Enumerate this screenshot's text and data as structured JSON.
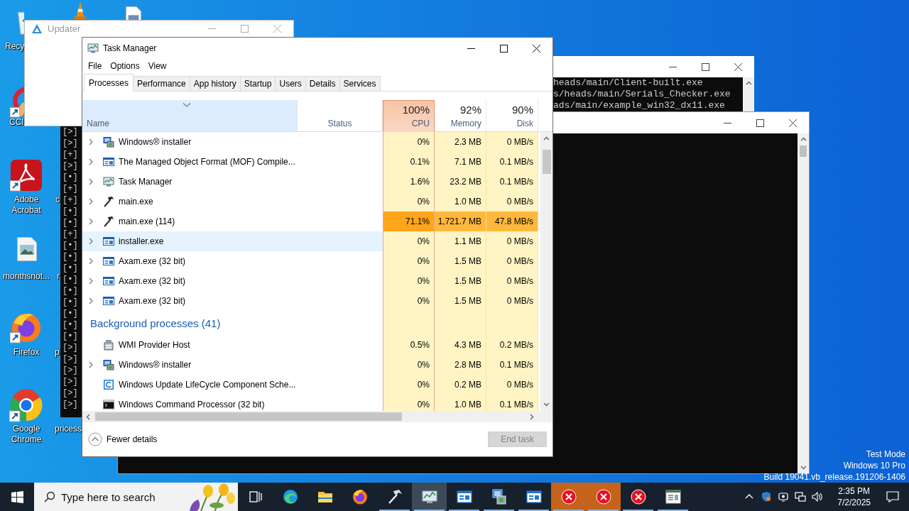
{
  "desktop": {
    "icons": [
      {
        "kind": "recycle-bin",
        "label": "Recy",
        "shortcut": false
      },
      {
        "kind": "cone"
      },
      {
        "kind": "document"
      },
      {
        "kind": "cleaner",
        "label": "CCl",
        "shortcut": true
      },
      {
        "kind": "pdf",
        "label": "Adobe Acrobat",
        "shortcut": true
      },
      {
        "kind": "covered",
        "label": "c"
      },
      {
        "kind": "image-file",
        "label": "monthsnot...",
        "shortcut": false
      },
      {
        "kind": "covered",
        "label": "r"
      },
      {
        "kind": "fox-browser",
        "label": "Firefox",
        "shortcut": true
      },
      {
        "kind": "covered",
        "label": "p"
      },
      {
        "kind": "round-browser",
        "label": "Google Chrome",
        "shortcut": true
      },
      {
        "kind": "covered",
        "label": "pricess"
      }
    ],
    "system_notice": [
      "Test Mode",
      "Windows 10 Pro",
      "Build 19041.vb_release.191206-1406"
    ]
  },
  "updater": {
    "title": "Updater"
  },
  "console_left": {
    "lines": [
      "[>]",
      "[>]",
      "[+]",
      "[>]",
      "[•]",
      "[+]",
      "[+]",
      "[•]",
      "[•]",
      "[+]",
      "[•]",
      "[•]",
      "[•]",
      "[•]",
      "[•]",
      "[•]",
      "[•]",
      "[•]",
      "[•]",
      "[>]",
      "[>]",
      "[>]",
      "[>]",
      "[>]",
      "[>]"
    ]
  },
  "console_top": {
    "lines": [
      "heads/main/Client-built.exe",
      "s/heads/main/Serials_Checker.exe",
      "ads/main/example_win32_dx11.exe"
    ]
  },
  "task_manager": {
    "title": "Task Manager",
    "menu": [
      "File",
      "Options",
      "View"
    ],
    "tabs": [
      {
        "label": "Processes",
        "selected": true
      },
      {
        "label": "Performance",
        "selected": false
      },
      {
        "label": "App history",
        "selected": false
      },
      {
        "label": "Startup",
        "selected": false
      },
      {
        "label": "Users",
        "selected": false
      },
      {
        "label": "Details",
        "selected": false
      },
      {
        "label": "Services",
        "selected": false
      }
    ],
    "columns": [
      {
        "label": "Name"
      },
      {
        "label": "Status"
      },
      {
        "label": "CPU",
        "usage": "100%",
        "hot": true
      },
      {
        "label": "Memory",
        "usage": "92%",
        "hot": false
      },
      {
        "label": "Disk",
        "usage": "90%",
        "hot": false
      }
    ],
    "rows": [
      {
        "kind": "installer",
        "name": "Windows® installer",
        "expandable": true,
        "selected": false,
        "hot": false,
        "cpu": "0%",
        "memory": "2.3 MB",
        "disk": "0 MB/s"
      },
      {
        "kind": "window",
        "name": "The Managed Object Format (MOF) Compile...",
        "expandable": true,
        "selected": false,
        "hot": false,
        "cpu": "0.1%",
        "memory": "7.1 MB",
        "disk": "0.1 MB/s"
      },
      {
        "kind": "monitor",
        "name": "Task Manager",
        "expandable": true,
        "selected": false,
        "hot": false,
        "cpu": "1.6%",
        "memory": "23.2 MB",
        "disk": "0.1 MB/s"
      },
      {
        "kind": "hammer",
        "name": "main.exe",
        "expandable": true,
        "selected": false,
        "hot": false,
        "cpu": "0%",
        "memory": "1.0 MB",
        "disk": "0 MB/s"
      },
      {
        "kind": "hammer",
        "name": "main.exe (114)",
        "expandable": true,
        "selected": false,
        "hot": true,
        "cpu": "71.1%",
        "memory": "1,721.7 MB",
        "disk": "47.8 MB/s"
      },
      {
        "kind": "window",
        "name": "installer.exe",
        "expandable": true,
        "selected": true,
        "hot": false,
        "cpu": "0%",
        "memory": "1.1 MB",
        "disk": "0 MB/s"
      },
      {
        "kind": "window",
        "name": "Axam.exe (32 bit)",
        "expandable": true,
        "selected": false,
        "hot": false,
        "cpu": "0%",
        "memory": "1.5 MB",
        "disk": "0 MB/s"
      },
      {
        "kind": "window",
        "name": "Axam.exe (32 bit)",
        "expandable": true,
        "selected": false,
        "hot": false,
        "cpu": "0%",
        "memory": "1.5 MB",
        "disk": "0 MB/s"
      },
      {
        "kind": "window",
        "name": "Axam.exe (32 bit)",
        "expandable": true,
        "selected": false,
        "hot": false,
        "cpu": "0%",
        "memory": "1.5 MB",
        "disk": "0 MB/s"
      },
      {
        "kind": "group",
        "name": "Background processes (41)"
      },
      {
        "kind": "server",
        "name": "WMI Provider Host",
        "expandable": false,
        "selected": false,
        "hot": false,
        "cpu": "0.5%",
        "memory": "4.3 MB",
        "disk": "0.2 MB/s"
      },
      {
        "kind": "installer",
        "name": "Windows® installer",
        "expandable": true,
        "selected": false,
        "hot": false,
        "cpu": "0%",
        "memory": "2.8 MB",
        "disk": "0.1 MB/s"
      },
      {
        "kind": "update",
        "name": "Windows Update LifeCycle Component Sche...",
        "expandable": false,
        "selected": false,
        "hot": false,
        "cpu": "0%",
        "memory": "0.2 MB",
        "disk": "0 MB/s"
      },
      {
        "kind": "console",
        "name": "Windows Command Processor (32 bit)",
        "expandable": false,
        "selected": false,
        "hot": false,
        "cpu": "0%",
        "memory": "1.0 MB",
        "disk": "0.1 MB/s"
      }
    ],
    "footer": {
      "toggle": "Fewer details",
      "end_task": {
        "label": "End task",
        "disabled": true
      }
    }
  },
  "taskbar": {
    "search": {
      "placeholder": "Type here to search"
    },
    "items": [
      {
        "kind": "task-view",
        "selected": false,
        "flashing": false,
        "running": false
      },
      {
        "kind": "wave-browser",
        "selected": false,
        "flashing": false,
        "running": false
      },
      {
        "kind": "folder",
        "selected": false,
        "flashing": false,
        "running": false
      },
      {
        "kind": "fox-browser",
        "selected": false,
        "flashing": false,
        "running": false
      },
      {
        "kind": "hammer",
        "selected": false,
        "flashing": false,
        "running": true
      },
      {
        "kind": "monitor",
        "selected": true,
        "flashing": false,
        "running": true
      },
      {
        "kind": "window",
        "selected": false,
        "flashing": false,
        "running": true
      },
      {
        "kind": "installer",
        "selected": false,
        "flashing": false,
        "running": true
      },
      {
        "kind": "window",
        "selected": false,
        "flashing": false,
        "running": true
      },
      {
        "kind": "error",
        "selected": false,
        "flashing": true,
        "running": true
      },
      {
        "kind": "error",
        "selected": false,
        "flashing": true,
        "running": true
      },
      {
        "kind": "error",
        "selected": false,
        "flashing": false,
        "running": true
      },
      {
        "kind": "document-window",
        "selected": false,
        "flashing": false,
        "running": true
      }
    ],
    "time": "2:35 PM",
    "date": "7/2/2025"
  }
}
